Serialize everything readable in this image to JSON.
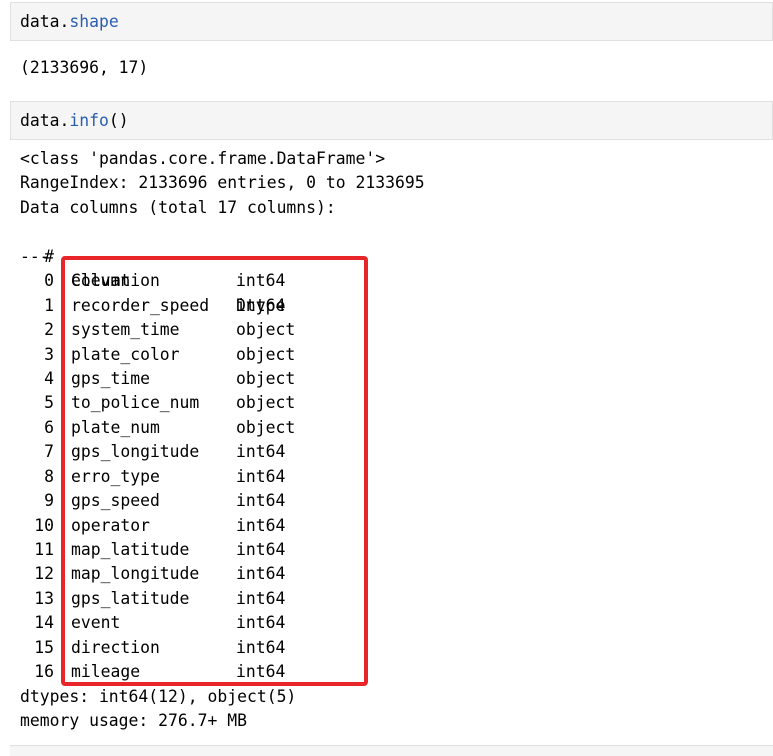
{
  "cells": [
    {
      "input": {
        "var": "data",
        "dot": ".",
        "attr": "shape",
        "suffix": ""
      },
      "output": "(2133696, 17)"
    },
    {
      "input": {
        "var": "data",
        "dot": ".",
        "attr": "info",
        "suffix": "()"
      }
    }
  ],
  "info": {
    "class_line": "<class 'pandas.core.frame.DataFrame'>",
    "range_line": "RangeIndex: 2133696 entries, 0 to 2133695",
    "columns_line": "Data columns (total 17 columns):",
    "header": {
      "num": "#",
      "column": "Column",
      "dtype": "Dtype"
    },
    "separator": "---",
    "rows": [
      {
        "num": "0",
        "name": "elevation",
        "dtype": "int64"
      },
      {
        "num": "1",
        "name": "recorder_speed",
        "dtype": "int64"
      },
      {
        "num": "2",
        "name": "system_time",
        "dtype": "object"
      },
      {
        "num": "3",
        "name": "plate_color",
        "dtype": "object"
      },
      {
        "num": "4",
        "name": "gps_time",
        "dtype": "object"
      },
      {
        "num": "5",
        "name": "to_police_num",
        "dtype": "object"
      },
      {
        "num": "6",
        "name": "plate_num",
        "dtype": "object"
      },
      {
        "num": "7",
        "name": "gps_longitude",
        "dtype": "int64"
      },
      {
        "num": "8",
        "name": "erro_type",
        "dtype": "int64"
      },
      {
        "num": "9",
        "name": "gps_speed",
        "dtype": "int64"
      },
      {
        "num": "10",
        "name": "operator",
        "dtype": "int64"
      },
      {
        "num": "11",
        "name": "map_latitude",
        "dtype": "int64"
      },
      {
        "num": "12",
        "name": "map_longitude",
        "dtype": "int64"
      },
      {
        "num": "13",
        "name": "gps_latitude",
        "dtype": "int64"
      },
      {
        "num": "14",
        "name": "event",
        "dtype": "int64"
      },
      {
        "num": "15",
        "name": "direction",
        "dtype": "int64"
      },
      {
        "num": "16",
        "name": "mileage",
        "dtype": "int64"
      }
    ],
    "dtypes_line": "dtypes: int64(12), object(5)",
    "memory_line": "memory usage: 276.7+ MB"
  },
  "colors": {
    "attribute": "#2a5db0",
    "highlight_box": "#e8262a",
    "cell_background": "#f5f5f5"
  }
}
